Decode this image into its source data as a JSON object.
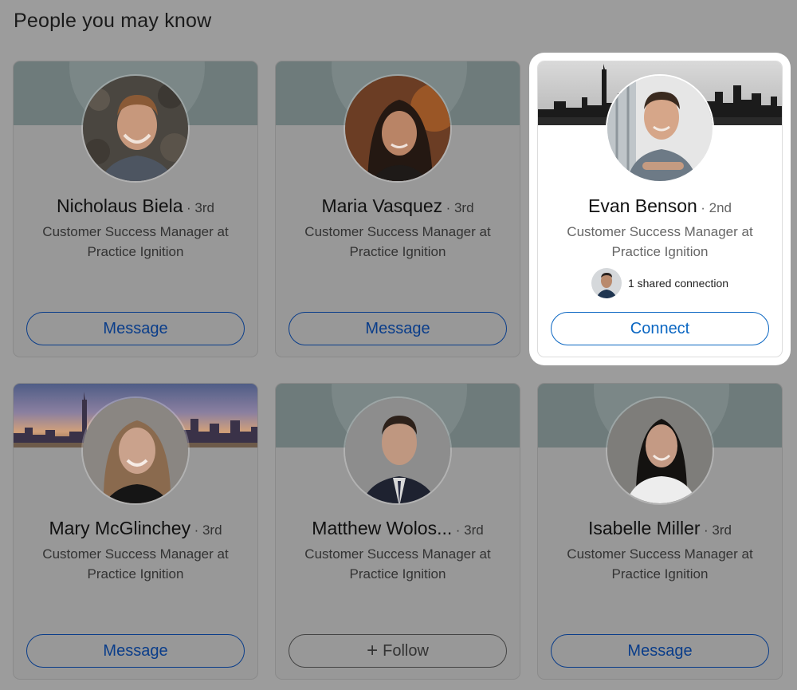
{
  "page": {
    "title": "People you may know"
  },
  "cards": [
    {
      "name": "Nicholaus Biela",
      "degree": "· 3rd",
      "headline": "Customer Success Manager at Practice Ignition",
      "action": "Message",
      "cover": "teal",
      "highlighted": false
    },
    {
      "name": "Maria Vasquez",
      "degree": "· 3rd",
      "headline": "Customer Success Manager at Practice Ignition",
      "action": "Message",
      "cover": "teal",
      "highlighted": false
    },
    {
      "name": "Evan Benson",
      "degree": "· 2nd",
      "headline": "Customer Success Manager at Practice Ignition",
      "shared": "1 shared connection",
      "action": "Connect",
      "cover": "city-skyline",
      "highlighted": true
    },
    {
      "name": "Mary McGlinchey",
      "degree": "· 3rd",
      "headline": "Customer Success Manager at Practice Ignition",
      "action": "Message",
      "cover": "city-skyline-dusk",
      "highlighted": false
    },
    {
      "name": "Matthew Wolos...",
      "degree": "· 3rd",
      "headline": "Customer Success Manager at Practice Ignition",
      "action": "Follow",
      "action_icon": "plus-icon",
      "cover": "teal",
      "highlighted": false
    },
    {
      "name": "Isabelle Miller",
      "degree": "· 3rd",
      "headline": "Customer Success Manager at Practice Ignition",
      "action": "Message",
      "cover": "teal",
      "highlighted": false
    }
  ],
  "colors": {
    "primary": "#0a66c2",
    "dim_overlay": "#9c9c9c"
  },
  "icons": {
    "plus": "+"
  }
}
